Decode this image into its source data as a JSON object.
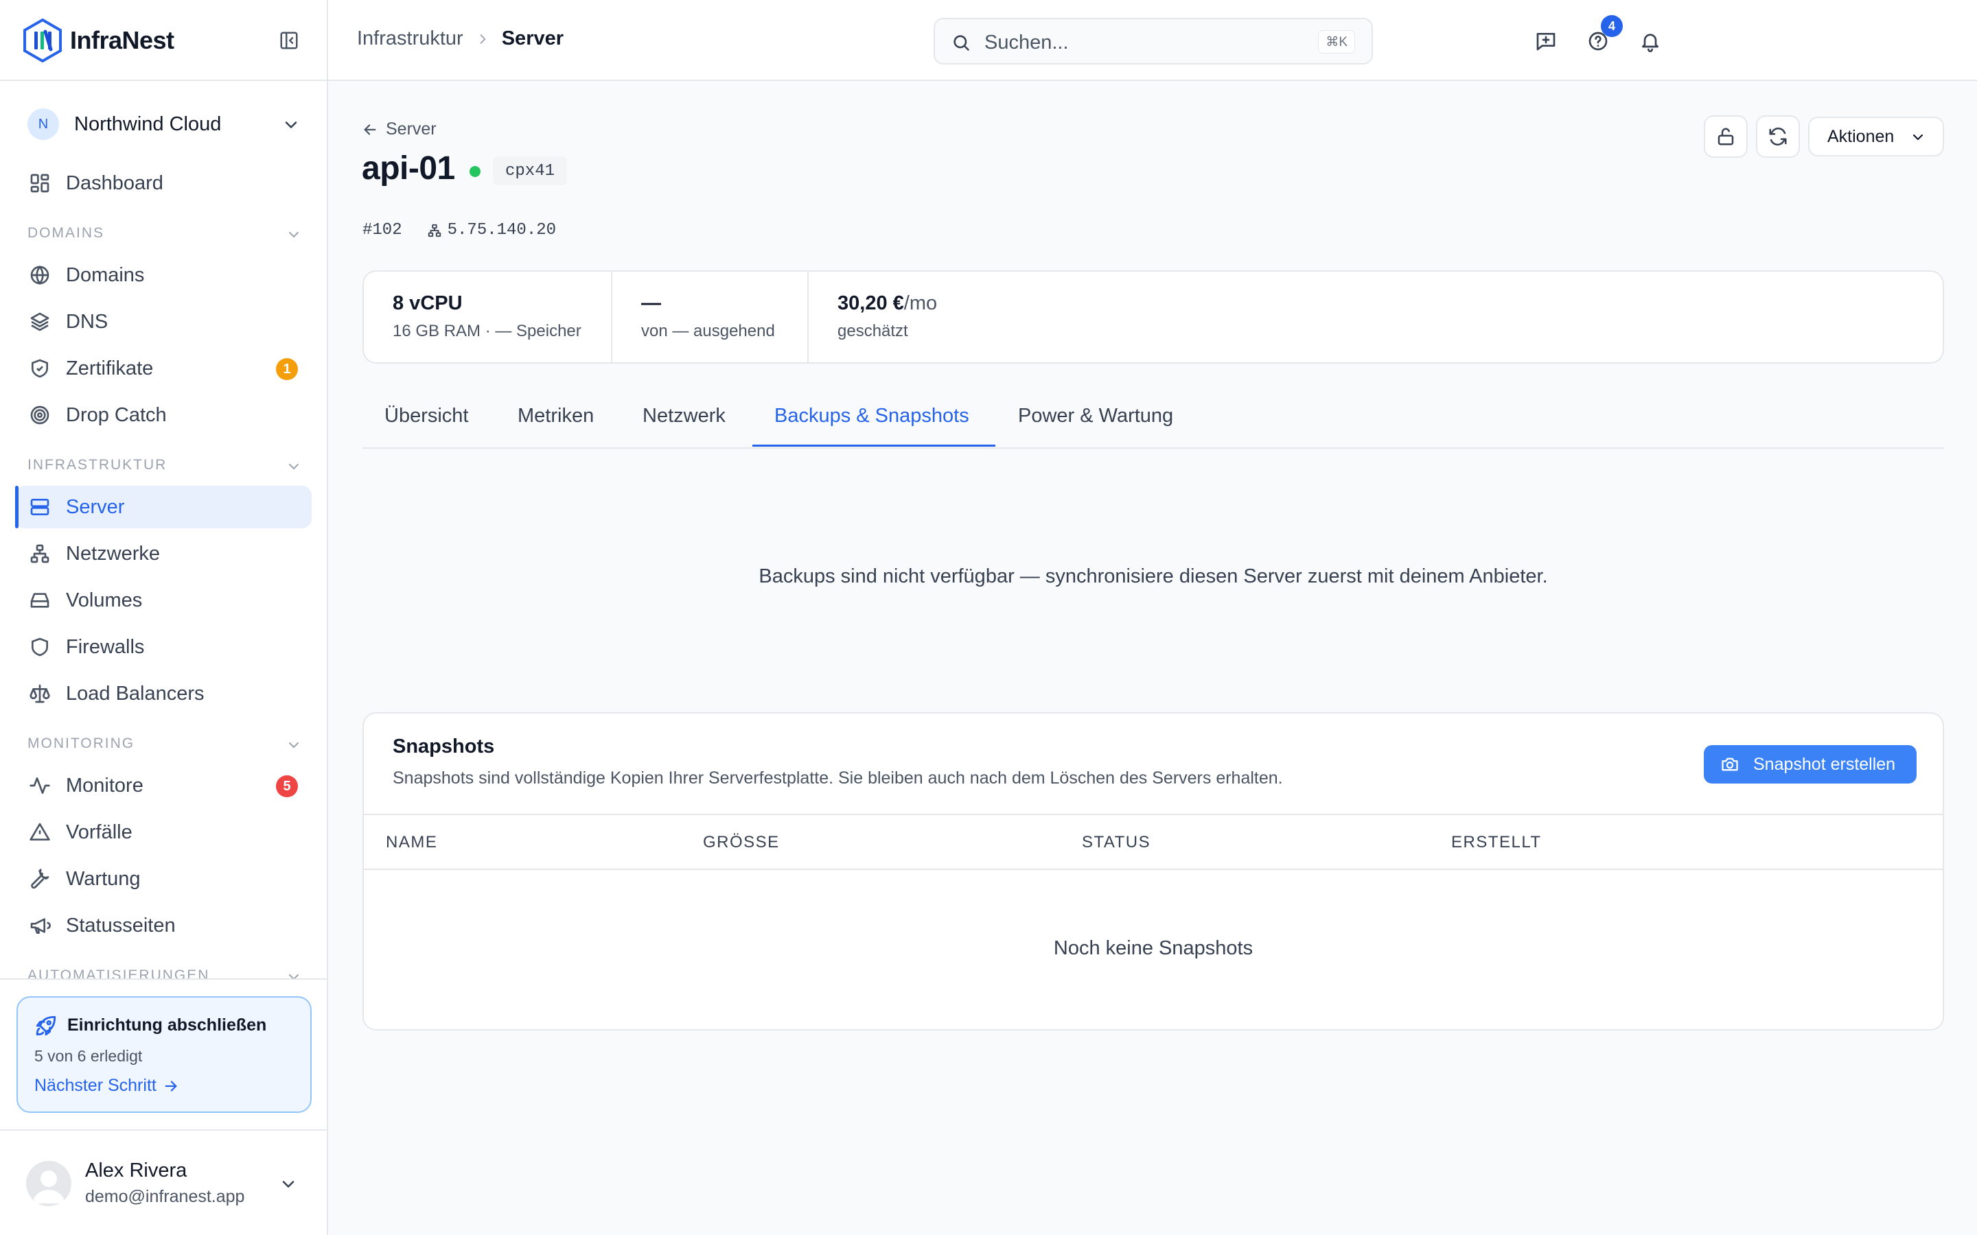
{
  "brand": {
    "name": "InfraNest"
  },
  "org": {
    "initial": "N",
    "name": "Northwind Cloud"
  },
  "nav": {
    "dashboard": "Dashboard",
    "domains_section": "DOMAINS",
    "domains": "Domains",
    "dns": "DNS",
    "certificates": "Zertifikate",
    "certificates_badge": "1",
    "drop_catch": "Drop Catch",
    "infra_section": "INFRASTRUKTUR",
    "server": "Server",
    "networks": "Netzwerke",
    "volumes": "Volumes",
    "firewalls": "Firewalls",
    "load_balancers": "Load Balancers",
    "monitoring_section": "MONITORING",
    "monitors": "Monitore",
    "monitors_badge": "5",
    "incidents": "Vorfälle",
    "maintenance": "Wartung",
    "status_pages": "Statusseiten",
    "automation_section": "AUTOMATISIERUNGEN"
  },
  "setup": {
    "title": "Einrichtung abschließen",
    "progress": "5 von 6 erledigt",
    "next": "Nächster Schritt"
  },
  "user": {
    "name": "Alex Rivera",
    "email": "demo@infranest.app"
  },
  "topbar": {
    "breadcrumb": [
      "Infrastruktur",
      "Server"
    ],
    "search_placeholder": "Suchen...",
    "search_shortcut": "⌘K",
    "notifications_count": "4"
  },
  "server": {
    "back_label": "Server",
    "name": "api-01",
    "plan": "cpx41",
    "id": "#102",
    "ip": "5.75.140.20",
    "actions_label": "Aktionen"
  },
  "stats": [
    {
      "value": "8 vCPU",
      "unit": "",
      "label": "16 GB RAM · — Speicher"
    },
    {
      "value": "—",
      "unit": "",
      "label": "von — ausgehend"
    },
    {
      "value": "30,20 €",
      "unit": "/mo",
      "label": "geschätzt"
    }
  ],
  "tabs": [
    "Übersicht",
    "Metriken",
    "Netzwerk",
    "Backups & Snapshots",
    "Power & Wartung"
  ],
  "active_tab": "Backups & Snapshots",
  "backups_message": "Backups sind nicht verfügbar — synchronisiere diesen Server zuerst mit deinem Anbieter.",
  "snapshots": {
    "title": "Snapshots",
    "description": "Snapshots sind vollständige Kopien Ihrer Serverfestplatte. Sie bleiben auch nach dem Löschen des Servers erhalten.",
    "create_button": "Snapshot erstellen",
    "columns": [
      "NAME",
      "GRÖSSE",
      "STATUS",
      "ERSTELLT"
    ],
    "empty": "Noch keine Snapshots"
  },
  "colors": {
    "accent": "#2563eb",
    "button_primary": "#3b82f6",
    "status_running": "#22c55e",
    "badge_warning": "#f59e0b",
    "badge_danger": "#ef4444"
  }
}
